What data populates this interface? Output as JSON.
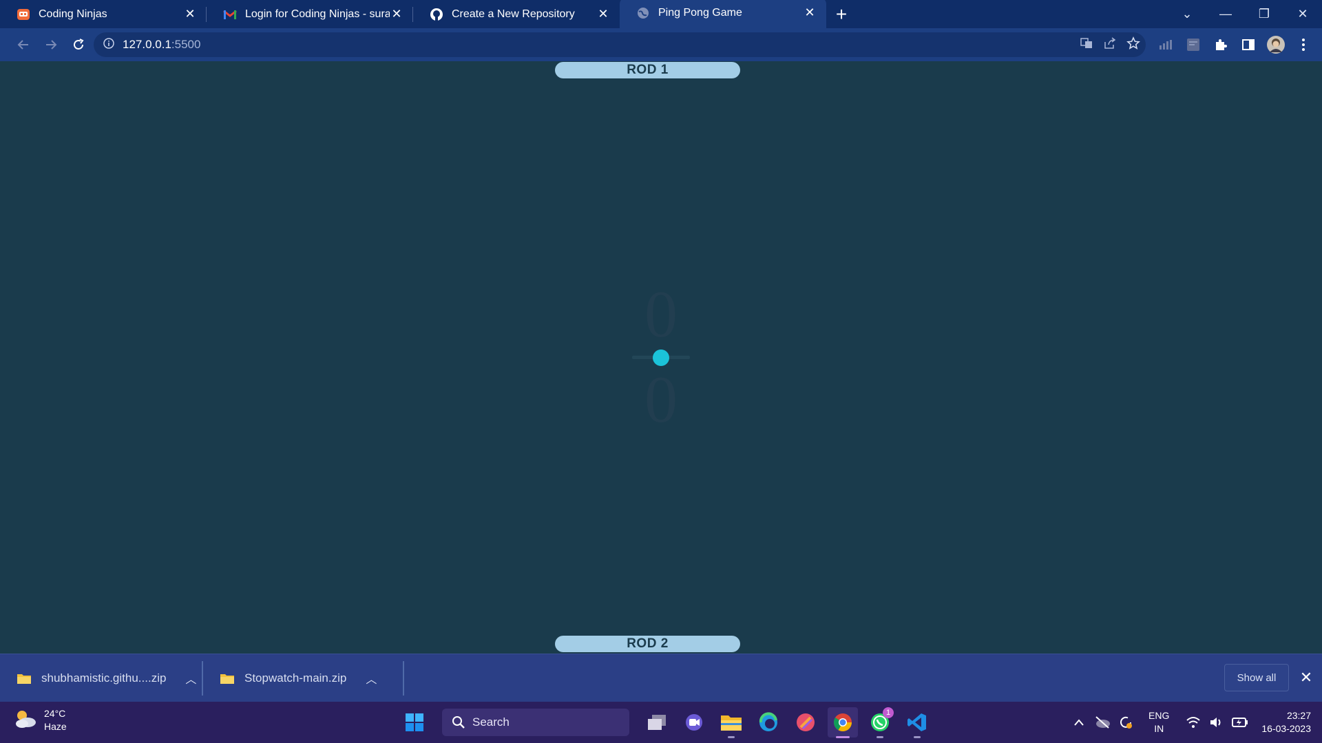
{
  "browser": {
    "tabs": [
      {
        "title": "Coding Ninjas",
        "icon": "coding-ninjas-icon",
        "active": false
      },
      {
        "title": "Login for Coding Ninjas - surajbh",
        "icon": "gmail-icon",
        "active": false
      },
      {
        "title": "Create a New Repository",
        "icon": "github-icon",
        "active": false
      },
      {
        "title": "Ping Pong Game",
        "icon": "globe-icon",
        "active": true
      }
    ],
    "url_host": "127.0.0.1",
    "url_port": ":5500"
  },
  "game": {
    "rod1_label": "ROD 1",
    "rod2_label": "ROD 2",
    "score_top": "0",
    "score_bottom": "0"
  },
  "downloads": {
    "items": [
      {
        "name": "shubhamistic.githu....zip"
      },
      {
        "name": "Stopwatch-main.zip"
      }
    ],
    "show_all_label": "Show all"
  },
  "taskbar": {
    "weather_temp": "24°C",
    "weather_desc": "Haze",
    "search_placeholder": "Search",
    "whatsapp_badge": "1",
    "lang_primary": "ENG",
    "lang_secondary": "IN",
    "time": "23:27",
    "date": "16-03-2023"
  },
  "colors": {
    "game_bg": "#1a3b4c",
    "rod": "#a3cde6",
    "ball": "#1bc3d9",
    "tabstrip": "#0f2d68",
    "toolbar": "#1d3f82",
    "taskbar": "#2a1f5e"
  }
}
